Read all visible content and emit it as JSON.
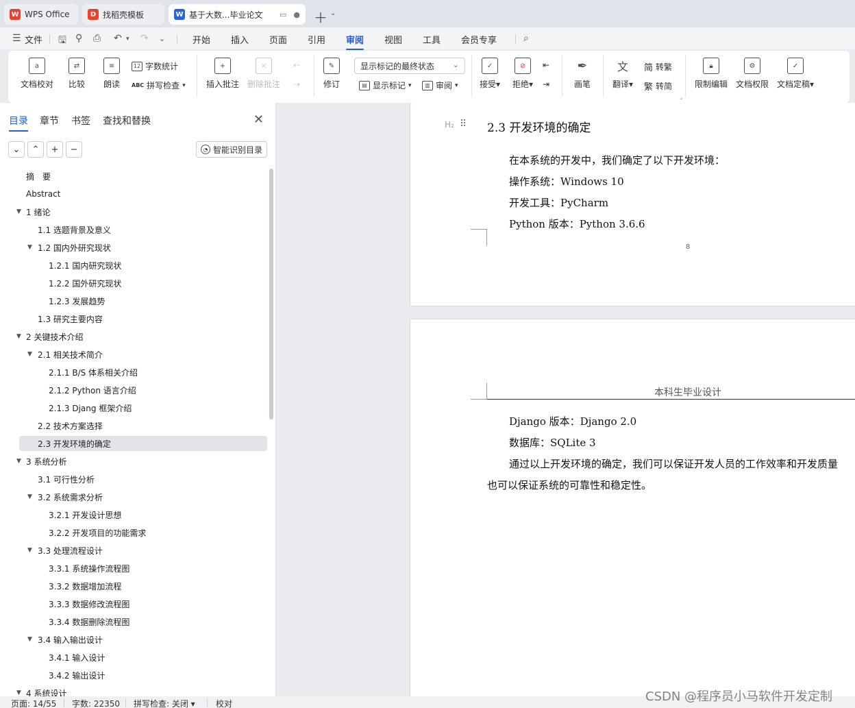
{
  "tabs": [
    {
      "label": "WPS Office",
      "logo": "W"
    },
    {
      "label": "找稻壳模板",
      "logo": "D"
    },
    {
      "label": "基于大数...毕业论文",
      "logo": "W"
    }
  ],
  "menu": {
    "file": "文件",
    "items": [
      "开始",
      "插入",
      "页面",
      "引用",
      "审阅",
      "视图",
      "工具",
      "会员专享"
    ],
    "active": "审阅"
  },
  "ribbon": {
    "doc_proof": "文档校对",
    "compare": "比较",
    "read_aloud": "朗读",
    "word_count": "字数统计",
    "spell_check": "拼写检查",
    "insert_comment": "插入批注",
    "delete_comment": "删除批注",
    "revise": "修订",
    "markup_state": "显示标记的最终状态",
    "show_markup": "显示标记",
    "review": "审阅",
    "accept": "接受",
    "reject": "拒绝",
    "pen": "画笔",
    "translate": "翻译",
    "to_traditional": "转繁",
    "to_simplified": "转简",
    "restrict_edit": "限制编辑",
    "doc_permission": "文档权限",
    "doc_finalize": "文档定稿"
  },
  "nav": {
    "tabs": [
      "目录",
      "章节",
      "书签",
      "查找和替换"
    ],
    "smart_toc": "智能识别目录",
    "toc": [
      {
        "label": "摘　要",
        "level": 1,
        "arrow": ""
      },
      {
        "label": "Abstract",
        "level": 1,
        "arrow": ""
      },
      {
        "label": "1  绪论",
        "level": 1,
        "arrow": "▼"
      },
      {
        "label": "1.1 选题背景及意义",
        "level": 2,
        "arrow": ""
      },
      {
        "label": "1.2 国内外研究现状",
        "level": 2,
        "arrow": "▼"
      },
      {
        "label": "1.2.1 国内研究现状",
        "level": 3,
        "arrow": ""
      },
      {
        "label": "1.2.2 国外研究现状",
        "level": 3,
        "arrow": ""
      },
      {
        "label": "1.2.3 发展趋势",
        "level": 3,
        "arrow": ""
      },
      {
        "label": "1.3 研究主要内容",
        "level": 2,
        "arrow": ""
      },
      {
        "label": "2  关键技术介绍",
        "level": 1,
        "arrow": "▼"
      },
      {
        "label": "2.1 相关技术简介",
        "level": 2,
        "arrow": "▼"
      },
      {
        "label": "2.1.1 B/S 体系相关介绍",
        "level": 3,
        "arrow": ""
      },
      {
        "label": "2.1.2 Python 语言介绍",
        "level": 3,
        "arrow": ""
      },
      {
        "label": "2.1.3 Djang 框架介绍",
        "level": 3,
        "arrow": ""
      },
      {
        "label": "2.2 技术方案选择",
        "level": 2,
        "arrow": ""
      },
      {
        "label": "2.3 开发环境的确定",
        "level": 2,
        "arrow": "",
        "selected": true
      },
      {
        "label": "3  系统分析",
        "level": 1,
        "arrow": "▼"
      },
      {
        "label": "3.1 可行性分析",
        "level": 2,
        "arrow": ""
      },
      {
        "label": "3.2  系统需求分析",
        "level": 2,
        "arrow": "▼"
      },
      {
        "label": "3.2.1  开发设计思想",
        "level": 3,
        "arrow": ""
      },
      {
        "label": "3.2.2  开发项目的功能需求",
        "level": 3,
        "arrow": ""
      },
      {
        "label": "3.3 处理流程设计",
        "level": 2,
        "arrow": "▼"
      },
      {
        "label": "3.3.1 系统操作流程图",
        "level": 3,
        "arrow": ""
      },
      {
        "label": "3.3.2 数据增加流程",
        "level": 3,
        "arrow": ""
      },
      {
        "label": "3.3.3 数据修改流程图",
        "level": 3,
        "arrow": ""
      },
      {
        "label": "3.3.4 数据删除流程图",
        "level": 3,
        "arrow": ""
      },
      {
        "label": "3.4 输入输出设计",
        "level": 2,
        "arrow": "▼"
      },
      {
        "label": "3.4.1 输入设计",
        "level": 3,
        "arrow": ""
      },
      {
        "label": "3.4.2 输出设计",
        "level": 3,
        "arrow": ""
      },
      {
        "label": "4  系统设计",
        "level": 1,
        "arrow": "▼"
      }
    ]
  },
  "document": {
    "heading_marker": "H₂",
    "heading": "2.3 开发环境的确定",
    "page1_lines": [
      "在本系统的开发中，我们确定了以下开发环境：",
      "操作系统：Windows 10",
      "开发工具：PyCharm",
      "Python  版本：Python 3.6.6"
    ],
    "page_number": "8",
    "page2_header": "本科生毕业设计",
    "page2_lines": [
      "Django  版本：Django 2.0",
      "数据库：SQLite 3",
      "通过以上开发环境的确定，我们可以保证开发人员的工作效率和开发质量",
      "也可以保证系统的可靠性和稳定性。"
    ]
  },
  "status": {
    "page": "页面: 14/55",
    "words": "字数: 22350",
    "spell": "拼写检查: 关闭",
    "proof": "校对"
  },
  "watermark": "CSDN @程序员小马软件开发定制",
  "colors": {
    "accent": "#1f5fd6",
    "wps_red": "#e8412f",
    "docer_red": "#e8412f",
    "word_blue": "#2b63d9"
  }
}
